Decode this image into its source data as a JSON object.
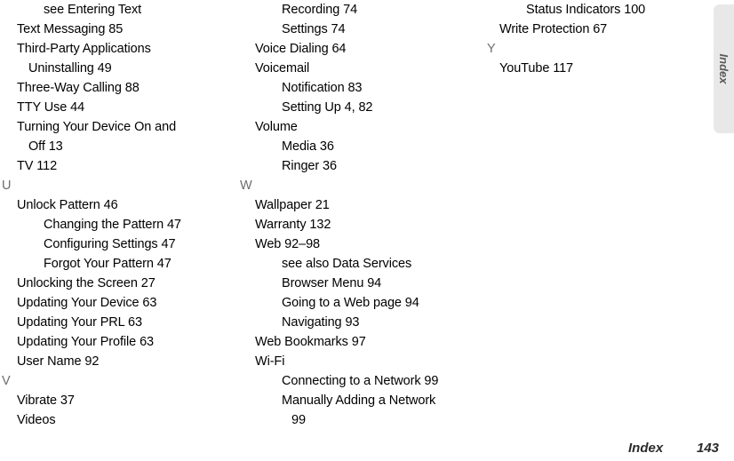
{
  "page": {
    "title": "Index",
    "page_number": "143"
  },
  "side_tab": {
    "label": "Index",
    "background_color": "#e8e8e8",
    "text_color": "#5a5a5a"
  },
  "footer": {
    "label": "Index",
    "page_number": "143"
  },
  "colors": {
    "body_text": "#000000",
    "letter_heading": "#6d6d6d",
    "footer_text": "#2b2b2b",
    "page_background": "#ffffff"
  },
  "columns": [
    {
      "id": "col-1",
      "entries": [
        {
          "level": "lvl2",
          "text": "see Entering Text"
        },
        {
          "level": "lvl1",
          "text": "Text Messaging 85"
        },
        {
          "level": "lvl1",
          "text": "Third-Party Applications"
        },
        {
          "level": "lvl1-wrap",
          "text": "Uninstalling 49"
        },
        {
          "level": "lvl1",
          "text": "Three-Way Calling 88"
        },
        {
          "level": "lvl1",
          "text": "TTY Use 44"
        },
        {
          "level": "lvl1",
          "text": "Turning Your Device On and"
        },
        {
          "level": "lvl1-wrap",
          "text": "Off 13"
        },
        {
          "level": "lvl1",
          "text": "TV 112"
        },
        {
          "level": "letter",
          "text": "U"
        },
        {
          "level": "lvl1",
          "text": "Unlock Pattern 46"
        },
        {
          "level": "lvl2",
          "text": "Changing the Pattern 47"
        },
        {
          "level": "lvl2",
          "text": "Configuring Settings 47"
        },
        {
          "level": "lvl2",
          "text": "Forgot Your Pattern 47"
        },
        {
          "level": "lvl1",
          "text": "Unlocking the Screen 27"
        },
        {
          "level": "lvl1",
          "text": "Updating Your Device 63"
        },
        {
          "level": "lvl1",
          "text": "Updating Your PRL 63"
        },
        {
          "level": "lvl1",
          "text": "Updating Your Profile 63"
        },
        {
          "level": "lvl1",
          "text": "User Name 92"
        },
        {
          "level": "letter",
          "text": "V"
        },
        {
          "level": "lvl1",
          "text": "Vibrate 37"
        },
        {
          "level": "lvl1",
          "text": "Videos"
        }
      ]
    },
    {
      "id": "col-2",
      "entries": [
        {
          "level": "lvl2",
          "text": "Recording 74"
        },
        {
          "level": "lvl2",
          "text": "Settings 74"
        },
        {
          "level": "lvl1",
          "text": "Voice Dialing 64"
        },
        {
          "level": "lvl1",
          "text": "Voicemail"
        },
        {
          "level": "lvl2",
          "text": "Notification 83"
        },
        {
          "level": "lvl2",
          "text": "Setting Up 4, 82"
        },
        {
          "level": "lvl1",
          "text": "Volume"
        },
        {
          "level": "lvl2",
          "text": "Media 36"
        },
        {
          "level": "lvl2",
          "text": "Ringer 36"
        },
        {
          "level": "letter",
          "text": "W"
        },
        {
          "level": "lvl1",
          "text": "Wallpaper 21"
        },
        {
          "level": "lvl1",
          "text": "Warranty 132"
        },
        {
          "level": "lvl1",
          "text": "Web 92–98"
        },
        {
          "level": "lvl2",
          "text": "see also Data Services"
        },
        {
          "level": "lvl2",
          "text": "Browser Menu 94"
        },
        {
          "level": "lvl2",
          "text": "Going to a Web page 94"
        },
        {
          "level": "lvl2",
          "text": "Navigating 93"
        },
        {
          "level": "lvl1",
          "text": "Web Bookmarks 97"
        },
        {
          "level": "lvl1",
          "text": "Wi-Fi"
        },
        {
          "level": "lvl2",
          "text": "Connecting to a Network 99"
        },
        {
          "level": "lvl2",
          "text": "Manually Adding a Network"
        },
        {
          "level": "lvl2-wrap",
          "text": "99"
        }
      ]
    },
    {
      "id": "col-3",
      "entries": [
        {
          "level": "lvl2",
          "text": "Status Indicators 100"
        },
        {
          "level": "lvl1",
          "text": "Write Protection 67"
        },
        {
          "level": "letter",
          "text": "Y"
        },
        {
          "level": "lvl1",
          "text": "YouTube 117"
        }
      ]
    }
  ]
}
